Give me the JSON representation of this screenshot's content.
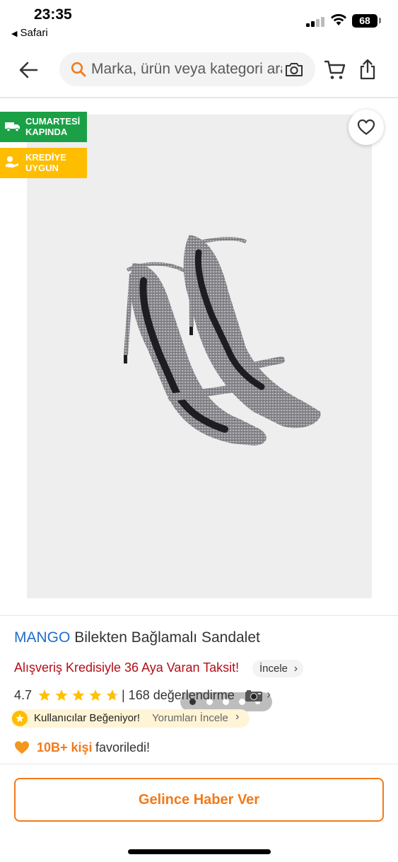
{
  "status_bar": {
    "time": "23:35",
    "back_app": "Safari",
    "battery": "68"
  },
  "header": {
    "search_placeholder": "Marka, ürün veya kategori ara"
  },
  "gallery": {
    "badges": [
      {
        "line1": "CUMARTESİ",
        "line2": "KAPINDA",
        "color": "#1ba046"
      },
      {
        "line1": "KREDİYE",
        "line2": "UYGUN",
        "color": "#ffbd00"
      }
    ],
    "image_count": 5,
    "active_index": 0
  },
  "product": {
    "brand": "MANGO",
    "name": "Bilekten Bağlamalı Sandalet",
    "credit_text": "Alışveriş Kredisiyle 36 Aya Varan Taksit!",
    "credit_link": "İncele",
    "rating": "4.7",
    "rating_value": 4.7,
    "review_count": "| 168 değerlendirme",
    "liked_title": "Kullanıcılar Beğeniyor!",
    "liked_link": "Yorumları İncele",
    "fav_count": "10B+ kişi",
    "fav_text": "favoriledi!"
  },
  "actions": {
    "notify_label": "Gelince Haber Ver"
  },
  "colors": {
    "accent": "#f27a1a",
    "brand": "#1f6fcc",
    "credit": "#b30e17"
  }
}
